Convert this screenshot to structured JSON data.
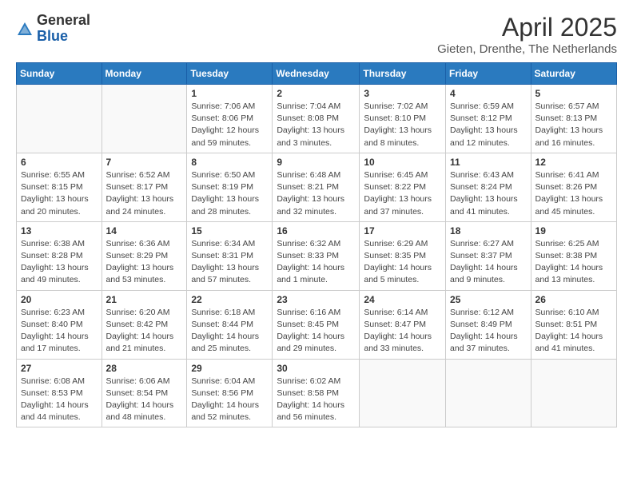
{
  "logo": {
    "general": "General",
    "blue": "Blue"
  },
  "title": "April 2025",
  "subtitle": "Gieten, Drenthe, The Netherlands",
  "days_of_week": [
    "Sunday",
    "Monday",
    "Tuesday",
    "Wednesday",
    "Thursday",
    "Friday",
    "Saturday"
  ],
  "weeks": [
    [
      {
        "day": "",
        "info": ""
      },
      {
        "day": "",
        "info": ""
      },
      {
        "day": "1",
        "info": "Sunrise: 7:06 AM\nSunset: 8:06 PM\nDaylight: 12 hours and 59 minutes."
      },
      {
        "day": "2",
        "info": "Sunrise: 7:04 AM\nSunset: 8:08 PM\nDaylight: 13 hours and 3 minutes."
      },
      {
        "day": "3",
        "info": "Sunrise: 7:02 AM\nSunset: 8:10 PM\nDaylight: 13 hours and 8 minutes."
      },
      {
        "day": "4",
        "info": "Sunrise: 6:59 AM\nSunset: 8:12 PM\nDaylight: 13 hours and 12 minutes."
      },
      {
        "day": "5",
        "info": "Sunrise: 6:57 AM\nSunset: 8:13 PM\nDaylight: 13 hours and 16 minutes."
      }
    ],
    [
      {
        "day": "6",
        "info": "Sunrise: 6:55 AM\nSunset: 8:15 PM\nDaylight: 13 hours and 20 minutes."
      },
      {
        "day": "7",
        "info": "Sunrise: 6:52 AM\nSunset: 8:17 PM\nDaylight: 13 hours and 24 minutes."
      },
      {
        "day": "8",
        "info": "Sunrise: 6:50 AM\nSunset: 8:19 PM\nDaylight: 13 hours and 28 minutes."
      },
      {
        "day": "9",
        "info": "Sunrise: 6:48 AM\nSunset: 8:21 PM\nDaylight: 13 hours and 32 minutes."
      },
      {
        "day": "10",
        "info": "Sunrise: 6:45 AM\nSunset: 8:22 PM\nDaylight: 13 hours and 37 minutes."
      },
      {
        "day": "11",
        "info": "Sunrise: 6:43 AM\nSunset: 8:24 PM\nDaylight: 13 hours and 41 minutes."
      },
      {
        "day": "12",
        "info": "Sunrise: 6:41 AM\nSunset: 8:26 PM\nDaylight: 13 hours and 45 minutes."
      }
    ],
    [
      {
        "day": "13",
        "info": "Sunrise: 6:38 AM\nSunset: 8:28 PM\nDaylight: 13 hours and 49 minutes."
      },
      {
        "day": "14",
        "info": "Sunrise: 6:36 AM\nSunset: 8:29 PM\nDaylight: 13 hours and 53 minutes."
      },
      {
        "day": "15",
        "info": "Sunrise: 6:34 AM\nSunset: 8:31 PM\nDaylight: 13 hours and 57 minutes."
      },
      {
        "day": "16",
        "info": "Sunrise: 6:32 AM\nSunset: 8:33 PM\nDaylight: 14 hours and 1 minute."
      },
      {
        "day": "17",
        "info": "Sunrise: 6:29 AM\nSunset: 8:35 PM\nDaylight: 14 hours and 5 minutes."
      },
      {
        "day": "18",
        "info": "Sunrise: 6:27 AM\nSunset: 8:37 PM\nDaylight: 14 hours and 9 minutes."
      },
      {
        "day": "19",
        "info": "Sunrise: 6:25 AM\nSunset: 8:38 PM\nDaylight: 14 hours and 13 minutes."
      }
    ],
    [
      {
        "day": "20",
        "info": "Sunrise: 6:23 AM\nSunset: 8:40 PM\nDaylight: 14 hours and 17 minutes."
      },
      {
        "day": "21",
        "info": "Sunrise: 6:20 AM\nSunset: 8:42 PM\nDaylight: 14 hours and 21 minutes."
      },
      {
        "day": "22",
        "info": "Sunrise: 6:18 AM\nSunset: 8:44 PM\nDaylight: 14 hours and 25 minutes."
      },
      {
        "day": "23",
        "info": "Sunrise: 6:16 AM\nSunset: 8:45 PM\nDaylight: 14 hours and 29 minutes."
      },
      {
        "day": "24",
        "info": "Sunrise: 6:14 AM\nSunset: 8:47 PM\nDaylight: 14 hours and 33 minutes."
      },
      {
        "day": "25",
        "info": "Sunrise: 6:12 AM\nSunset: 8:49 PM\nDaylight: 14 hours and 37 minutes."
      },
      {
        "day": "26",
        "info": "Sunrise: 6:10 AM\nSunset: 8:51 PM\nDaylight: 14 hours and 41 minutes."
      }
    ],
    [
      {
        "day": "27",
        "info": "Sunrise: 6:08 AM\nSunset: 8:53 PM\nDaylight: 14 hours and 44 minutes."
      },
      {
        "day": "28",
        "info": "Sunrise: 6:06 AM\nSunset: 8:54 PM\nDaylight: 14 hours and 48 minutes."
      },
      {
        "day": "29",
        "info": "Sunrise: 6:04 AM\nSunset: 8:56 PM\nDaylight: 14 hours and 52 minutes."
      },
      {
        "day": "30",
        "info": "Sunrise: 6:02 AM\nSunset: 8:58 PM\nDaylight: 14 hours and 56 minutes."
      },
      {
        "day": "",
        "info": ""
      },
      {
        "day": "",
        "info": ""
      },
      {
        "day": "",
        "info": ""
      }
    ]
  ]
}
